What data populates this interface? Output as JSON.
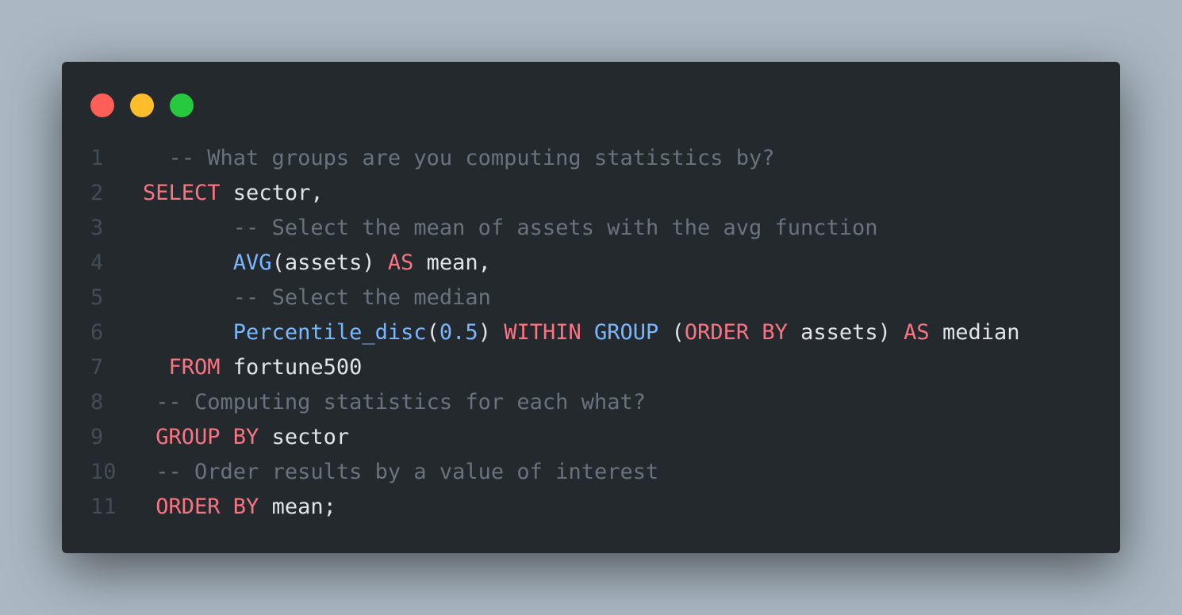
{
  "window": {
    "controls": [
      {
        "name": "close",
        "color": "#ff5f56"
      },
      {
        "name": "minimize",
        "color": "#ffbd2e"
      },
      {
        "name": "maximize",
        "color": "#27c93f"
      }
    ]
  },
  "colors": {
    "background": "#abb8c3",
    "editor_bg": "#24292e",
    "comment": "#6a737d",
    "keyword": "#f97583",
    "function": "#79b8ff",
    "plain": "#e1e4e8",
    "line_number": "#444c56"
  },
  "code": {
    "lines": [
      {
        "num": "1",
        "tokens": [
          {
            "t": "plain",
            "v": "  "
          },
          {
            "t": "comment",
            "v": "-- What groups are you computing statistics by?"
          }
        ]
      },
      {
        "num": "2",
        "tokens": [
          {
            "t": "keyword",
            "v": "SELECT"
          },
          {
            "t": "plain",
            "v": " sector,"
          }
        ]
      },
      {
        "num": "3",
        "tokens": [
          {
            "t": "plain",
            "v": "       "
          },
          {
            "t": "comment",
            "v": "-- Select the mean of assets with the avg function"
          }
        ]
      },
      {
        "num": "4",
        "tokens": [
          {
            "t": "plain",
            "v": "       "
          },
          {
            "t": "func",
            "v": "AVG"
          },
          {
            "t": "plain",
            "v": "(assets) "
          },
          {
            "t": "keyword",
            "v": "AS"
          },
          {
            "t": "plain",
            "v": " mean,"
          }
        ]
      },
      {
        "num": "5",
        "tokens": [
          {
            "t": "plain",
            "v": "       "
          },
          {
            "t": "comment",
            "v": "-- Select the median"
          }
        ]
      },
      {
        "num": "6",
        "tokens": [
          {
            "t": "plain",
            "v": "       "
          },
          {
            "t": "func",
            "v": "Percentile_disc"
          },
          {
            "t": "plain",
            "v": "("
          },
          {
            "t": "number",
            "v": "0.5"
          },
          {
            "t": "plain",
            "v": ") "
          },
          {
            "t": "keyword",
            "v": "WITHIN"
          },
          {
            "t": "plain",
            "v": " "
          },
          {
            "t": "func",
            "v": "GROUP"
          },
          {
            "t": "plain",
            "v": " ("
          },
          {
            "t": "keyword",
            "v": "ORDER BY"
          },
          {
            "t": "plain",
            "v": " assets) "
          },
          {
            "t": "keyword",
            "v": "AS"
          },
          {
            "t": "plain",
            "v": " median"
          }
        ]
      },
      {
        "num": "7",
        "tokens": [
          {
            "t": "plain",
            "v": "  "
          },
          {
            "t": "keyword",
            "v": "FROM"
          },
          {
            "t": "plain",
            "v": " fortune500"
          }
        ]
      },
      {
        "num": "8",
        "tokens": [
          {
            "t": "plain",
            "v": " "
          },
          {
            "t": "comment",
            "v": "-- Computing statistics for each what?"
          }
        ]
      },
      {
        "num": "9",
        "tokens": [
          {
            "t": "plain",
            "v": " "
          },
          {
            "t": "keyword",
            "v": "GROUP BY"
          },
          {
            "t": "plain",
            "v": " sector"
          }
        ]
      },
      {
        "num": "10",
        "tokens": [
          {
            "t": "plain",
            "v": " "
          },
          {
            "t": "comment",
            "v": "-- Order results by a value of interest"
          }
        ]
      },
      {
        "num": "11",
        "tokens": [
          {
            "t": "plain",
            "v": " "
          },
          {
            "t": "keyword",
            "v": "ORDER BY"
          },
          {
            "t": "plain",
            "v": " mean;"
          }
        ]
      }
    ]
  }
}
